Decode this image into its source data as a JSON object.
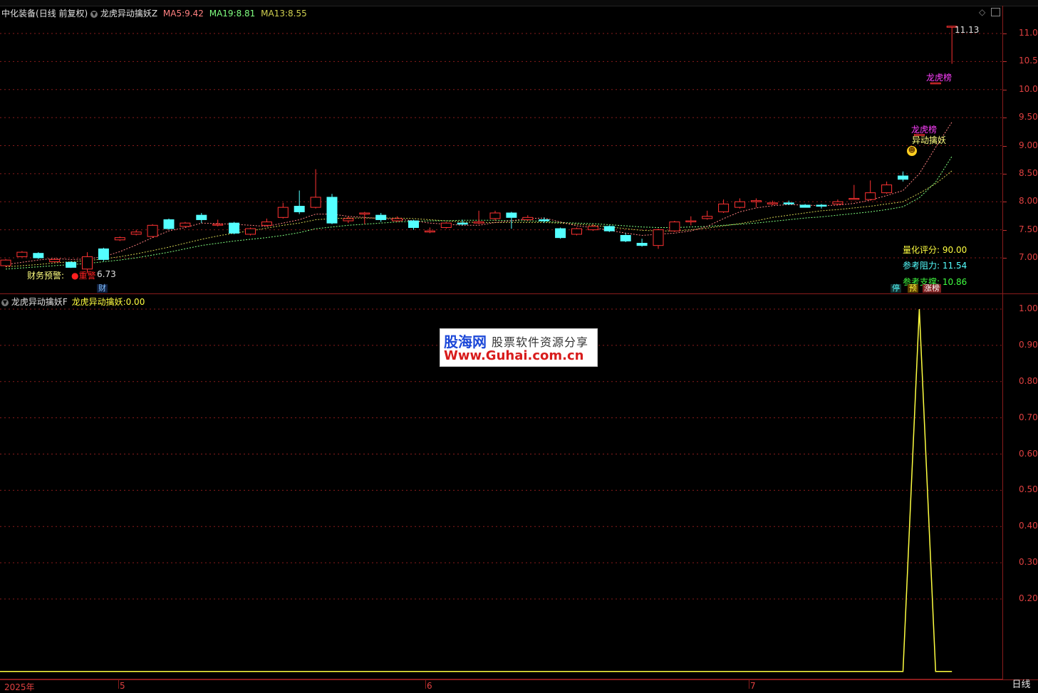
{
  "stock": {
    "name": "中化装备",
    "mode": "(日线 前复权)",
    "indicator": "龙虎异动擒妖Z",
    "ma5_label": "MA5:",
    "ma5_value": "9.42",
    "ma19_label": "MA19:",
    "ma19_value": "8.81",
    "ma13_label": "MA13:",
    "ma13_value": "8.55"
  },
  "colors": {
    "up": "#ff3232",
    "down": "#54ffff",
    "ma5": "#ff8080",
    "ma19": "#80ff80",
    "ma13": "#d0d050",
    "grid": "#8a1c1c",
    "yellow": "#ffff40"
  },
  "price_axis": {
    "labels": [
      "11.00",
      "10.50",
      "10.00",
      "9.50",
      "9.00",
      "8.50",
      "8.00",
      "7.50",
      "7.00"
    ]
  },
  "candles": [
    [
      6.86,
      6.96,
      6.98,
      6.84
    ],
    [
      7.02,
      7.1,
      7.12,
      7.01
    ],
    [
      7.08,
      7.0,
      7.1,
      6.98
    ],
    [
      6.93,
      6.97,
      6.99,
      6.92
    ],
    [
      6.92,
      6.83,
      6.94,
      6.82
    ],
    [
      6.8,
      7.02,
      7.1,
      6.73
    ],
    [
      7.16,
      6.97,
      7.18,
      6.94
    ],
    [
      7.32,
      7.36,
      7.38,
      7.3
    ],
    [
      7.42,
      7.46,
      7.5,
      7.4
    ],
    [
      7.38,
      7.58,
      7.6,
      7.36
    ],
    [
      7.68,
      7.52,
      7.7,
      7.5
    ],
    [
      7.56,
      7.62,
      7.64,
      7.54
    ],
    [
      7.76,
      7.68,
      7.8,
      7.62
    ],
    [
      7.6,
      7.6,
      7.68,
      7.56
    ],
    [
      7.62,
      7.44,
      7.64,
      7.42
    ],
    [
      7.42,
      7.52,
      7.54,
      7.4
    ],
    [
      7.58,
      7.64,
      7.7,
      7.56
    ],
    [
      7.72,
      7.9,
      7.98,
      7.7
    ],
    [
      7.92,
      7.82,
      8.2,
      7.78
    ],
    [
      7.9,
      8.08,
      8.58,
      7.88
    ],
    [
      8.08,
      7.62,
      8.14,
      7.6
    ],
    [
      7.66,
      7.7,
      7.74,
      7.62
    ],
    [
      7.78,
      7.8,
      7.82,
      7.6
    ],
    [
      7.76,
      7.68,
      7.8,
      7.64
    ],
    [
      7.66,
      7.7,
      7.74,
      7.64
    ],
    [
      7.66,
      7.54,
      7.68,
      7.5
    ],
    [
      7.46,
      7.48,
      7.54,
      7.44
    ],
    [
      7.54,
      7.62,
      7.64,
      7.52
    ],
    [
      7.62,
      7.6,
      7.68,
      7.58
    ],
    [
      7.62,
      7.64,
      7.84,
      7.6
    ],
    [
      7.7,
      7.8,
      7.84,
      7.66
    ],
    [
      7.8,
      7.72,
      7.82,
      7.52
    ],
    [
      7.68,
      7.72,
      7.76,
      7.66
    ],
    [
      7.68,
      7.66,
      7.72,
      7.62
    ],
    [
      7.52,
      7.36,
      7.54,
      7.34
    ],
    [
      7.42,
      7.52,
      7.54,
      7.4
    ],
    [
      7.5,
      7.56,
      7.6,
      7.48
    ],
    [
      7.56,
      7.48,
      7.58,
      7.46
    ],
    [
      7.4,
      7.3,
      7.44,
      7.28
    ],
    [
      7.26,
      7.22,
      7.34,
      7.2
    ],
    [
      7.22,
      7.5,
      7.52,
      7.16
    ],
    [
      7.48,
      7.64,
      7.66,
      7.46
    ],
    [
      7.66,
      7.66,
      7.74,
      7.58
    ],
    [
      7.7,
      7.74,
      7.84,
      7.68
    ],
    [
      7.82,
      7.96,
      8.04,
      7.8
    ],
    [
      7.9,
      8.0,
      8.06,
      7.88
    ],
    [
      8.0,
      8.02,
      8.06,
      7.9
    ],
    [
      7.96,
      7.98,
      8.02,
      7.94
    ],
    [
      7.98,
      7.96,
      8.02,
      7.94
    ],
    [
      7.94,
      7.9,
      7.96,
      7.9
    ],
    [
      7.94,
      7.92,
      7.96,
      7.88
    ],
    [
      7.96,
      8.0,
      8.04,
      7.94
    ],
    [
      8.06,
      8.06,
      8.3,
      8.04
    ],
    [
      8.04,
      8.16,
      8.38,
      8.02
    ],
    [
      8.16,
      8.3,
      8.36,
      8.14
    ],
    [
      8.46,
      8.4,
      8.54,
      8.36
    ],
    [
      9.2,
      9.2,
      9.2,
      9.2
    ],
    [
      10.12,
      10.12,
      10.12,
      10.12
    ],
    [
      11.13,
      11.13,
      11.13,
      10.46
    ]
  ],
  "ma_values": {
    "ma5": [
      6.88,
      6.92,
      6.96,
      6.99,
      6.97,
      6.98,
      7.02,
      7.11,
      7.23,
      7.36,
      7.48,
      7.54,
      7.62,
      7.61,
      7.6,
      7.58,
      7.56,
      7.62,
      7.68,
      7.78,
      7.78,
      7.74,
      7.72,
      7.7,
      7.69,
      7.66,
      7.62,
      7.6,
      7.58,
      7.58,
      7.63,
      7.66,
      7.7,
      7.71,
      7.64,
      7.57,
      7.54,
      7.49,
      7.44,
      7.4,
      7.42,
      7.44,
      7.48,
      7.56,
      7.7,
      7.82,
      7.89,
      7.93,
      7.95,
      7.94,
      7.93,
      7.94,
      7.97,
      8.03,
      8.11,
      8.2,
      8.5,
      8.97,
      9.42
    ],
    "ma19": [
      6.8,
      6.82,
      6.84,
      6.86,
      6.88,
      6.9,
      6.93,
      6.96,
      7.0,
      7.05,
      7.1,
      7.16,
      7.22,
      7.26,
      7.3,
      7.33,
      7.36,
      7.4,
      7.45,
      7.52,
      7.55,
      7.58,
      7.6,
      7.62,
      7.64,
      7.65,
      7.66,
      7.66,
      7.67,
      7.67,
      7.67,
      7.66,
      7.66,
      7.65,
      7.63,
      7.62,
      7.61,
      7.59,
      7.57,
      7.55,
      7.54,
      7.54,
      7.55,
      7.56,
      7.58,
      7.6,
      7.62,
      7.65,
      7.68,
      7.71,
      7.73,
      7.76,
      7.79,
      7.82,
      7.86,
      7.91,
      8.07,
      8.35,
      8.81
    ],
    "ma13": [
      6.84,
      6.86,
      6.88,
      6.91,
      6.93,
      6.95,
      6.98,
      7.02,
      7.07,
      7.13,
      7.19,
      7.26,
      7.33,
      7.39,
      7.44,
      7.48,
      7.53,
      7.58,
      7.62,
      7.68,
      7.7,
      7.71,
      7.71,
      7.71,
      7.71,
      7.7,
      7.68,
      7.66,
      7.64,
      7.63,
      7.63,
      7.63,
      7.63,
      7.63,
      7.62,
      7.6,
      7.58,
      7.55,
      7.52,
      7.49,
      7.48,
      7.48,
      7.5,
      7.53,
      7.57,
      7.61,
      7.66,
      7.72,
      7.76,
      7.8,
      7.84,
      7.86,
      7.89,
      7.92,
      7.96,
      8.0,
      8.15,
      8.32,
      8.55
    ]
  },
  "annotations": {
    "high_label": "11.13",
    "low_label": "6.73",
    "longhu_1": "龙虎榜",
    "longhu_2": "龙虎榜",
    "yidong": "异动擒妖",
    "finance_warning": "财务预警:",
    "finance_mark": "重",
    "finance_mark2": "警",
    "cai_badge": "财"
  },
  "scores": {
    "quant_label": "量化评分:",
    "quant_value": "90.00",
    "resist_label": "参考阻力:",
    "resist_value": "11.54",
    "support_label": "参考支撑:",
    "support_value": "10.86"
  },
  "tags": {
    "t1": "停",
    "t2": "预",
    "t3": "涨榜"
  },
  "sub": {
    "indicator": "龙虎异动擒妖F",
    "line_label": "龙虎异动擒妖:",
    "line_value": "0.00",
    "axis_labels": [
      "1.00",
      "0.90",
      "0.80",
      "0.70",
      "0.60",
      "0.50",
      "0.40",
      "0.30",
      "0.20"
    ],
    "signal_values": [
      0,
      0,
      0,
      0,
      0,
      0,
      0,
      0,
      0,
      0,
      0,
      0,
      0,
      0,
      0,
      0,
      0,
      0,
      0,
      0,
      0,
      0,
      0,
      0,
      0,
      0,
      0,
      0,
      0,
      0,
      0,
      0,
      0,
      0,
      0,
      0,
      0,
      0,
      0,
      0,
      0,
      0,
      0,
      0,
      0,
      0,
      0,
      0,
      0,
      0,
      0,
      0,
      0,
      0,
      0,
      0,
      1,
      0,
      0
    ]
  },
  "x_axis": {
    "labels": [
      "2025年",
      "5",
      "6",
      "7"
    ]
  },
  "watermark": {
    "line1": "股海网",
    "line2": "股票软件资源分享",
    "line3": "Www.Guhai.com.cn"
  },
  "period_button": "日线"
}
